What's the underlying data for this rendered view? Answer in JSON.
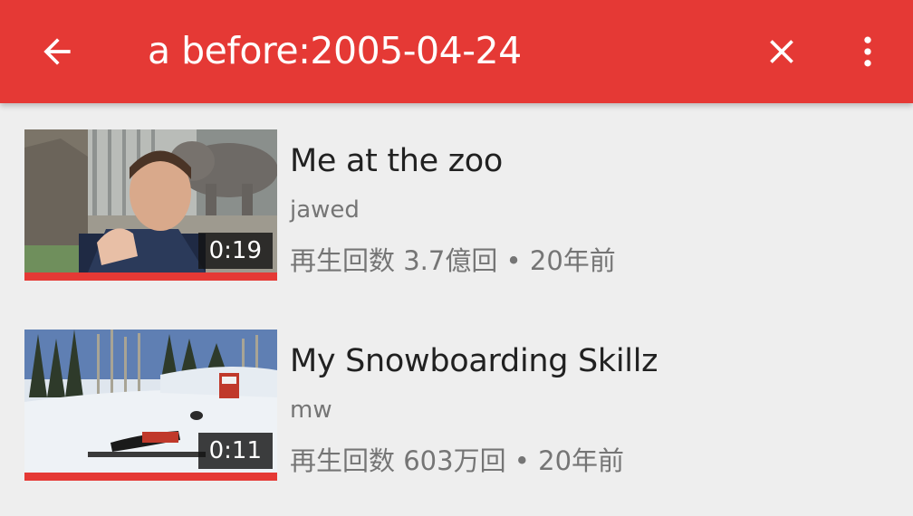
{
  "appbar": {
    "background": "#e53935",
    "back_icon": "arrow-left-icon",
    "search_query": "a before:2005-04-24",
    "clear_icon": "close-icon",
    "more_icon": "more-vert-icon"
  },
  "results": [
    {
      "title": "Me at the zoo",
      "channel": "jawed",
      "stats": "再生回数 3.7億回 • 20年前",
      "duration": "0:19",
      "watched_progress": 1.0
    },
    {
      "title": "My Snowboarding Skillz",
      "channel": "mw",
      "stats": "再生回数 603万回 • 20年前",
      "duration": "0:11",
      "watched_progress": 1.0
    }
  ]
}
